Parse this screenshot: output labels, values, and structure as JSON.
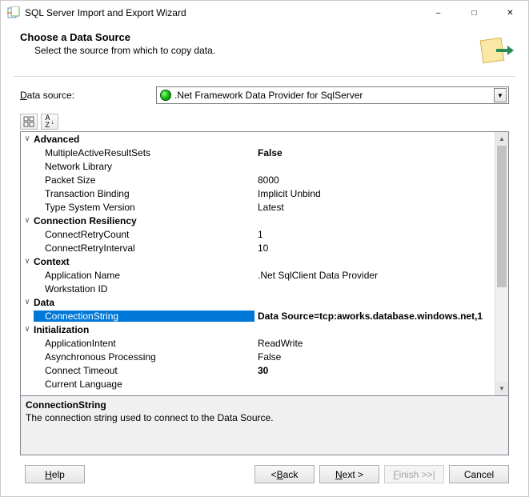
{
  "window": {
    "title": "SQL Server Import and Export Wizard"
  },
  "header": {
    "title": "Choose a Data Source",
    "subtitle": "Select the source from which to copy data."
  },
  "source_row": {
    "label_prefix": "D",
    "label_rest": "ata source:",
    "selected": ".Net Framework Data Provider for SqlServer"
  },
  "toolbar": {
    "categorized_tip": "Categorized",
    "alpha_tip": "Alphabetical"
  },
  "categories": [
    {
      "name": "Advanced",
      "expanded": true,
      "props": [
        {
          "name": "MultipleActiveResultSets",
          "value": "False",
          "bold": true
        },
        {
          "name": "Network Library",
          "value": ""
        },
        {
          "name": "Packet Size",
          "value": "8000"
        },
        {
          "name": "Transaction Binding",
          "value": "Implicit Unbind"
        },
        {
          "name": "Type System Version",
          "value": "Latest"
        }
      ]
    },
    {
      "name": "Connection Resiliency",
      "expanded": true,
      "props": [
        {
          "name": "ConnectRetryCount",
          "value": "1"
        },
        {
          "name": "ConnectRetryInterval",
          "value": "10"
        }
      ]
    },
    {
      "name": "Context",
      "expanded": true,
      "props": [
        {
          "name": "Application Name",
          "value": ".Net SqlClient Data Provider"
        },
        {
          "name": "Workstation ID",
          "value": ""
        }
      ]
    },
    {
      "name": "Data",
      "expanded": true,
      "props": [
        {
          "name": "ConnectionString",
          "value": "Data Source=tcp:aworks.database.windows.net,1",
          "selected": true
        }
      ]
    },
    {
      "name": "Initialization",
      "expanded": true,
      "props": [
        {
          "name": "ApplicationIntent",
          "value": "ReadWrite"
        },
        {
          "name": "Asynchronous Processing",
          "value": "False"
        },
        {
          "name": "Connect Timeout",
          "value": "30",
          "bold": true
        },
        {
          "name": "Current Language",
          "value": ""
        }
      ]
    }
  ],
  "description": {
    "title": "ConnectionString",
    "text": "The connection string used to connect to the Data Source."
  },
  "buttons": {
    "help": "Help",
    "back": "< Back",
    "next": "Next >",
    "finish": "Finish >>|",
    "cancel": "Cancel"
  }
}
